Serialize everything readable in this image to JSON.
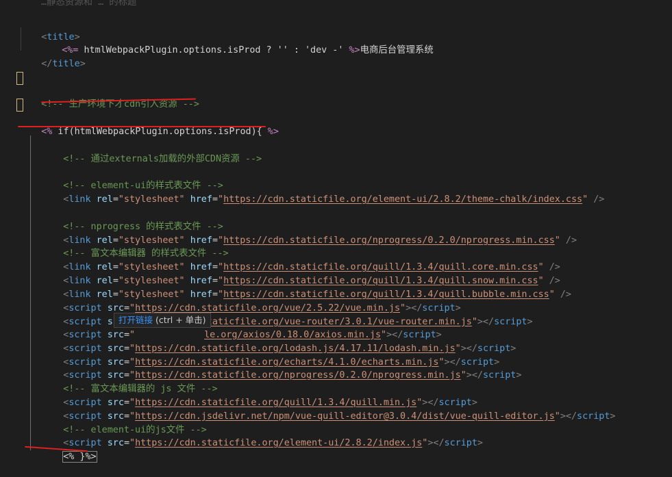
{
  "colors": {
    "background": "#1e1e1e",
    "tag": "#569cd6",
    "attribute": "#9cdcfe",
    "string": "#ce9178",
    "comment": "#6a9955",
    "template_delimiter": "#c586c0",
    "annotation": "#e02020"
  },
  "top_partial": "…静态资源和 … 的标题",
  "title_open": "title",
  "title_template_open": "<%=",
  "title_expr": " htmlWebpackPlugin.options.isProd ? '' : 'dev -' ",
  "title_template_close": "%>",
  "title_text": "电商后台管理系统",
  "title_close": "title",
  "cdn_comment": "<!-- 生产环境下才cdn引入资源 -->",
  "if_open": "<%",
  "if_expr": " if(htmlWebpackPlugin.options.isProd){ ",
  "if_close": "%>",
  "comments": {
    "externals": "<!-- 通过externals加载的外部CDN资源 -->",
    "element_css": "<!-- element-ui的样式表文件 -->",
    "nprogress_css": "<!-- nprogress 的样式表文件 -->",
    "quill_css": "<!-- 富文本编辑器 的样式表文件 -->",
    "quill_js": "<!-- 富文本编辑器的 js 文件 -->",
    "element_js": "<!-- element-ui的js文件 -->"
  },
  "links": [
    "https://cdn.staticfile.org/element-ui/2.8.2/theme-chalk/index.css",
    "https://cdn.staticfile.org/nprogress/0.2.0/nprogress.min.css",
    "https://cdn.staticfile.org/quill/1.3.4/quill.core.min.css",
    "https://cdn.staticfile.org/quill/1.3.4/quill.snow.min.css",
    "https://cdn.staticfile.org/quill/1.3.4/quill.bubble.min.css"
  ],
  "scripts": [
    "https://cdn.staticfile.org/vue/2.5.22/vue.min.js",
    "https://cdn.staticfile.org/vue-router/3.0.1/vue-router.min.js",
    "le.org/axios/0.18.0/axios.min.js",
    "https://cdn.staticfile.org/lodash.js/4.17.11/lodash.min.js",
    "https://cdn.staticfile.org/echarts/4.1.0/echarts.min.js",
    "https://cdn.staticfile.org/nprogress/0.2.0/nprogress.min.js",
    "https://cdn.staticfile.org/quill/1.3.4/quill.min.js",
    "https://cdn.jsdelivr.net/npm/vue-quill-editor@3.0.4/dist/vue-quill-editor.js",
    "https://cdn.staticfile.org/element-ui/2.8.2/index.js"
  ],
  "end_tag": "<% }%>",
  "tooltip": {
    "link_text": "打开链接",
    "hint": " (ctrl + 单击)"
  }
}
